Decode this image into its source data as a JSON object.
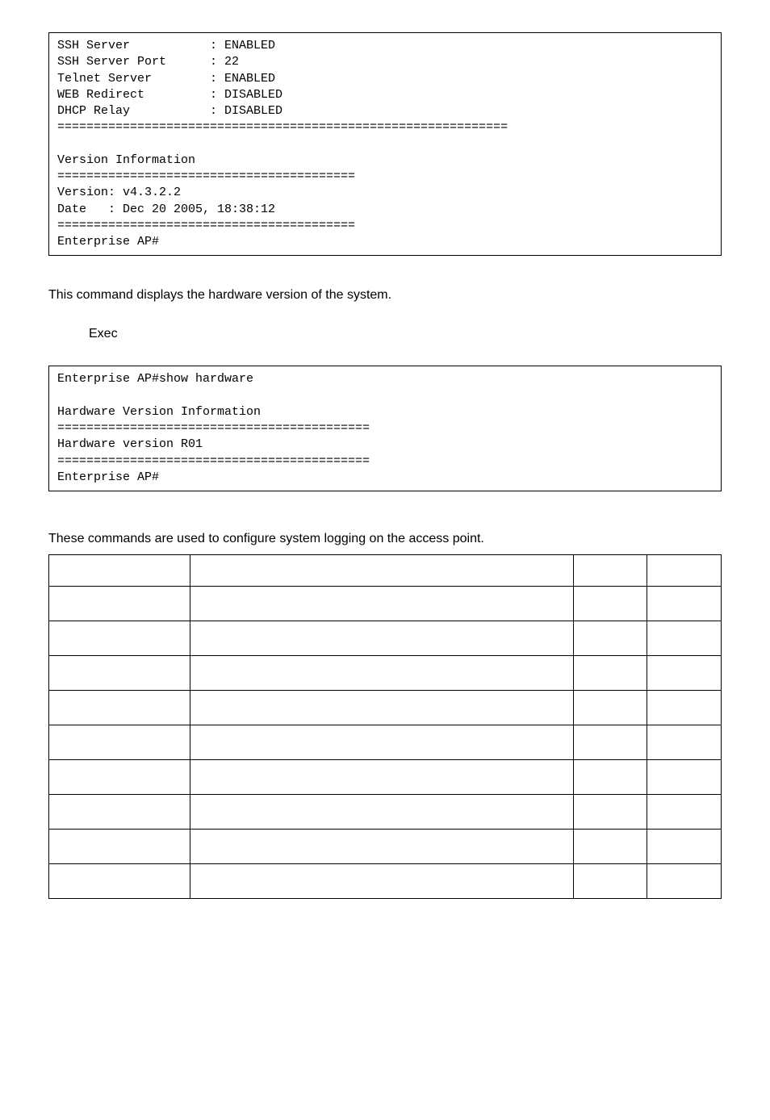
{
  "codeblock1": "SSH Server           : ENABLED\nSSH Server Port      : 22\nTelnet Server        : ENABLED\nWEB Redirect         : DISABLED\nDHCP Relay           : DISABLED\n==============================================================\n\nVersion Information\n=========================================\nVersion: v4.3.2.2\nDate   : Dec 20 2005, 18:38:12\n=========================================\nEnterprise AP#",
  "text1": "This command displays the hardware version of the system.",
  "text_exec": "Exec",
  "codeblock2": "Enterprise AP#show hardware\n\nHardware Version Information\n===========================================\nHardware version R01\n===========================================\nEnterprise AP#",
  "text2": "These commands are used to configure system logging on the access point.",
  "table": {
    "headers": [
      "",
      "",
      "",
      ""
    ],
    "rows": [
      [
        "",
        "",
        "",
        ""
      ],
      [
        "",
        "",
        "",
        ""
      ],
      [
        "",
        "",
        "",
        ""
      ],
      [
        "",
        "",
        "",
        ""
      ],
      [
        "",
        "",
        "",
        ""
      ],
      [
        "",
        "",
        "",
        ""
      ],
      [
        "",
        "",
        "",
        ""
      ],
      [
        "",
        "",
        "",
        ""
      ],
      [
        "",
        "",
        "",
        ""
      ]
    ]
  }
}
